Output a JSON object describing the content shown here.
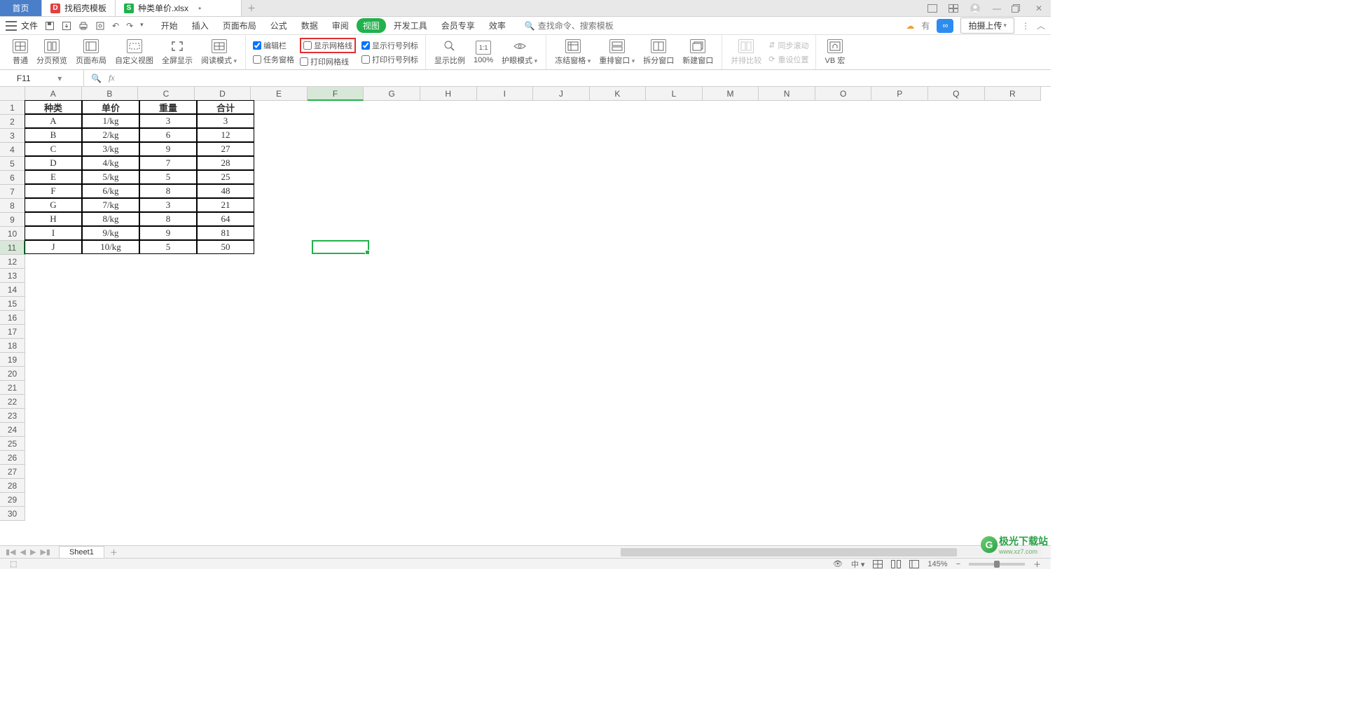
{
  "tabs": {
    "home": "首页",
    "template": "找稻壳模板",
    "file": "种类单价.xlsx"
  },
  "menubar": {
    "file": "文件",
    "items": [
      "开始",
      "插入",
      "页面布局",
      "公式",
      "数据",
      "审阅",
      "视图",
      "开发工具",
      "会员专享",
      "效率"
    ],
    "active": "视图",
    "search_placeholder": "查找命令、搜索模板"
  },
  "right_tools": {
    "cloud_label": "有",
    "upload": "拍摄上传"
  },
  "ribbon": {
    "view_modes": [
      "普通",
      "分页预览",
      "页面布局",
      "自定义视图",
      "全屏显示",
      "阅读模式"
    ],
    "checks": {
      "editbar": "编辑栏",
      "taskpane": "任务窗格",
      "gridlines": "显示网格线",
      "print_grid": "打印网格线",
      "headings": "显示行号列标",
      "print_head": "打印行号列标"
    },
    "buttons": {
      "zoom": "显示比例",
      "hundred": "100%",
      "eye": "护眼模式",
      "freeze": "冻结窗格",
      "arrange": "重排窗口",
      "split": "拆分窗口",
      "new_win": "新建窗口",
      "side": "并排比较",
      "sync": "同步滚动",
      "reset": "重设位置",
      "macro": "VB 宏"
    }
  },
  "namebox": "F11",
  "columns": [
    "A",
    "B",
    "C",
    "D",
    "E",
    "F",
    "G",
    "H",
    "I",
    "J",
    "K",
    "L",
    "M",
    "N",
    "O",
    "P",
    "Q",
    "R"
  ],
  "col_widths": {
    "default": 82,
    "main": 82
  },
  "rows_count": 30,
  "selected": {
    "col": "F",
    "row": 11
  },
  "sheet_tabs": {
    "active": "Sheet1"
  },
  "status": {
    "zoom": "145%"
  },
  "watermark": {
    "name": "极光下载站",
    "url": "www.xz7.com"
  },
  "table": {
    "headers": [
      "种类",
      "单价",
      "重量",
      "合计"
    ],
    "rows": [
      [
        "A",
        "1/kg",
        "3",
        "3"
      ],
      [
        "B",
        "2/kg",
        "6",
        "12"
      ],
      [
        "C",
        "3/kg",
        "9",
        "27"
      ],
      [
        "D",
        "4/kg",
        "7",
        "28"
      ],
      [
        "E",
        "5/kg",
        "5",
        "25"
      ],
      [
        "F",
        "6/kg",
        "8",
        "48"
      ],
      [
        "G",
        "7/kg",
        "3",
        "21"
      ],
      [
        "H",
        "8/kg",
        "8",
        "64"
      ],
      [
        "I",
        "9/kg",
        "9",
        "81"
      ],
      [
        "J",
        "10/kg",
        "5",
        "50"
      ]
    ]
  }
}
